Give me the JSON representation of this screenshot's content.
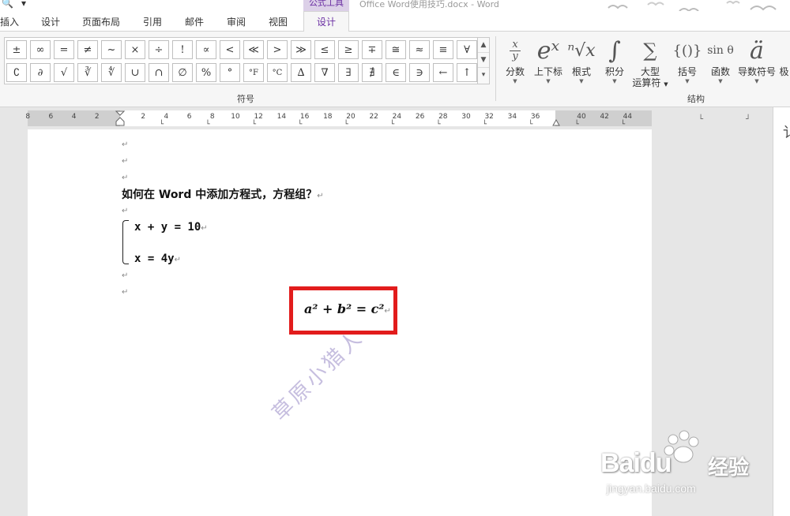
{
  "titlebar": {
    "context_tools": "公式工具",
    "document_title": "Office Word使用技巧.docx - Word"
  },
  "tabs": {
    "insert": "插入",
    "design": "设计",
    "layout": "页面布局",
    "references": "引用",
    "mailings": "邮件",
    "review": "审阅",
    "view": "视图",
    "equation_design": "设计"
  },
  "symbols": {
    "row1": [
      "±",
      "∞",
      "=",
      "≠",
      "~",
      "×",
      "÷",
      "!",
      "∝",
      "<",
      "≪",
      ">",
      "≫",
      "≤",
      "≥",
      "∓",
      "≅",
      "≈",
      "≡",
      "∀"
    ],
    "row2": [
      "∁",
      "∂",
      "√",
      "∛",
      "∜",
      "∪",
      "∩",
      "∅",
      "%",
      "°",
      "°F",
      "°C",
      "∆",
      "∇",
      "∃",
      "∄",
      "∈",
      "∋",
      "←",
      "↑"
    ],
    "group_label": "符号"
  },
  "structures": {
    "fraction": "分数",
    "script": "上下标",
    "radical": "根式",
    "integral": "积分",
    "large_operator_1": "大型",
    "large_operator_2": "运算符",
    "bracket": "括号",
    "function": "函数",
    "accent": "导数符号",
    "limit": "极",
    "group_label": "结构",
    "fraction_glyph_top": "x",
    "fraction_glyph_bottom": "y",
    "script_glyph": "eˣ",
    "radical_glyph": "ⁿ√x",
    "integral_glyph": "∫",
    "large_op_glyph": "∑",
    "bracket_glyph": "{()}",
    "function_glyph": "sin θ",
    "accent_glyph": "ä"
  },
  "ruler": {
    "left_labels": [
      "8",
      "6",
      "4",
      "2"
    ],
    "right_labels": [
      "2",
      "4",
      "6",
      "8",
      "10",
      "12",
      "14",
      "16",
      "18",
      "20",
      "22",
      "24",
      "26",
      "28",
      "30",
      "32",
      "34",
      "36",
      "40",
      "42",
      "44"
    ]
  },
  "document": {
    "para_mark": "↵",
    "heading": "如何在 Word 中添加方程式，方程组？",
    "eq1": "x + y = 10",
    "eq2": "x = 4y",
    "pythagoras": "a² + b² = c²",
    "watermark": "草原小猎人"
  },
  "baidu": {
    "brand": "Baidu",
    "jingyan": "经验",
    "url": "jingyan.baidu.com"
  },
  "right_pane": {
    "glyph": "讠"
  }
}
